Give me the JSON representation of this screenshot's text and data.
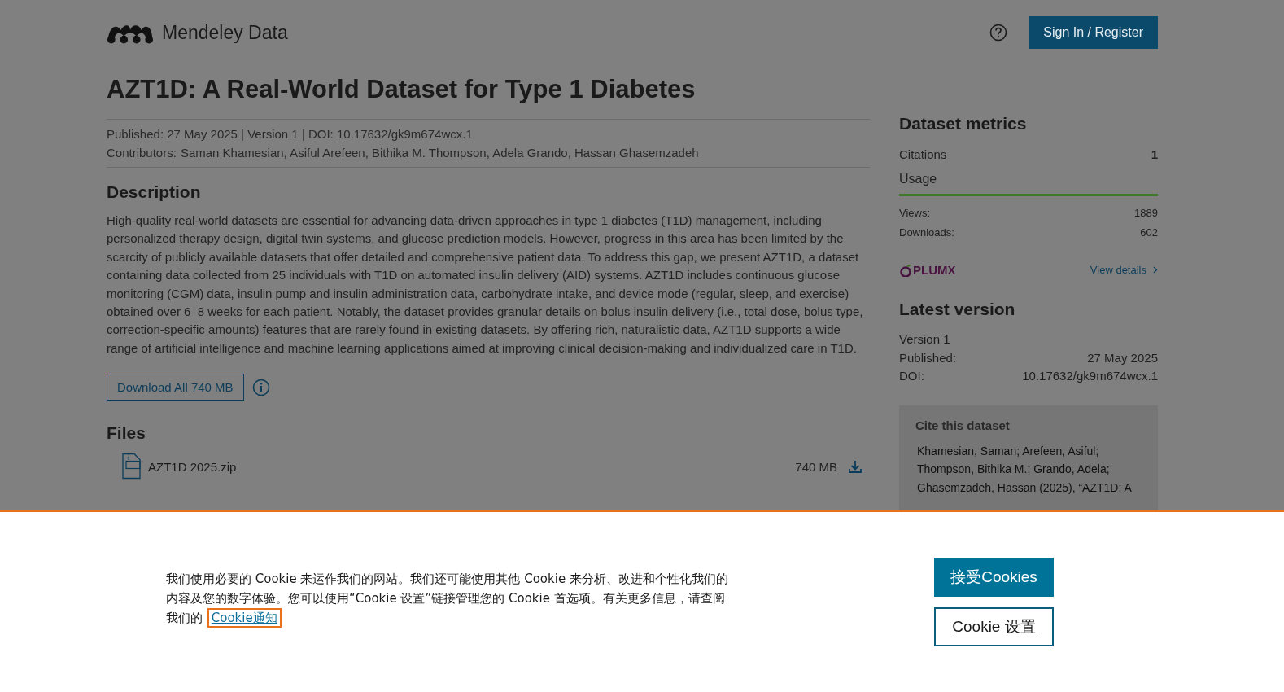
{
  "header": {
    "brand": "Mendeley Data",
    "sign_in": "Sign In / Register"
  },
  "dataset": {
    "title": "AZT1D: A Real-World Dataset for Type 1 Diabetes",
    "meta": "Published: 27 May 2025 | Version 1 | DOI: 10.17632/gk9m674wcx.1",
    "contributors_label": "Contributors:",
    "contributors": "Saman Khamesian, Asiful Arefeen, Bithika M. Thompson, Adela Grando, Hassan Ghasemzadeh"
  },
  "description": {
    "heading": "Description",
    "text": "High-quality real-world datasets are essential for advancing data-driven approaches in type 1 diabetes (T1D) management, including personalized therapy design, digital twin systems, and glucose prediction models. However, progress in this area has been limited by the scarcity of publicly available datasets that offer detailed and comprehensive patient data. To address this gap, we present AZT1D, a dataset containing data collected from 25 individuals with T1D on automated insulin delivery (AID) systems. AZT1D includes continuous glucose monitoring (CGM) data, insulin pump and insulin administration data, carbohydrate intake, and device mode (regular, sleep, and exercise) obtained over 6–8 weeks for each patient. Notably, the dataset provides granular details on bolus insulin delivery (i.e., total dose, bolus type, correction-specific amounts) features that are rarely found in existing datasets. By offering rich, naturalistic data, AZT1D supports a wide range of artificial intelligence and machine learning applications aimed at improving clinical decision-making and individualized care in T1D."
  },
  "download_all": "Download All 740 MB",
  "files": {
    "heading": "Files",
    "items": [
      {
        "name": "AZT1D 2025.zip",
        "size": "740 MB"
      }
    ]
  },
  "metrics": {
    "heading": "Dataset metrics",
    "citations": {
      "label": "Citations",
      "value": "1"
    },
    "usage_label": "Usage",
    "usage": [
      {
        "label": "Views:",
        "value": "1889"
      },
      {
        "label": "Downloads:",
        "value": "602"
      }
    ],
    "plumx": "PLUMX",
    "view_details": "View details"
  },
  "latest_version": {
    "heading": "Latest version",
    "version": "Version 1",
    "fields": [
      {
        "label": "Published:",
        "value": "27 May 2025"
      },
      {
        "label": "DOI:",
        "value": "10.17632/gk9m674wcx.1"
      }
    ]
  },
  "cite": {
    "heading": "Cite this dataset",
    "text": "Khamesian, Saman; Arefeen, Asiful; Thompson, Bithika M.; Grando, Adela; Ghasemzadeh, Hassan (2025), “AZT1D:  A"
  },
  "cookie_banner": {
    "text": "我们使用必要的 Cookie 来运作我们的网站。我们还可能使用其他 Cookie 来分析、改进和个性化我们的内容及您的数字体验。您可以使用“Cookie 设置”链接管理您的 Cookie 首选项。有关更多信息，请查阅我们的 ",
    "link": "Cookie通知",
    "accept": "接受Cookies",
    "settings": "Cookie 设置"
  }
}
